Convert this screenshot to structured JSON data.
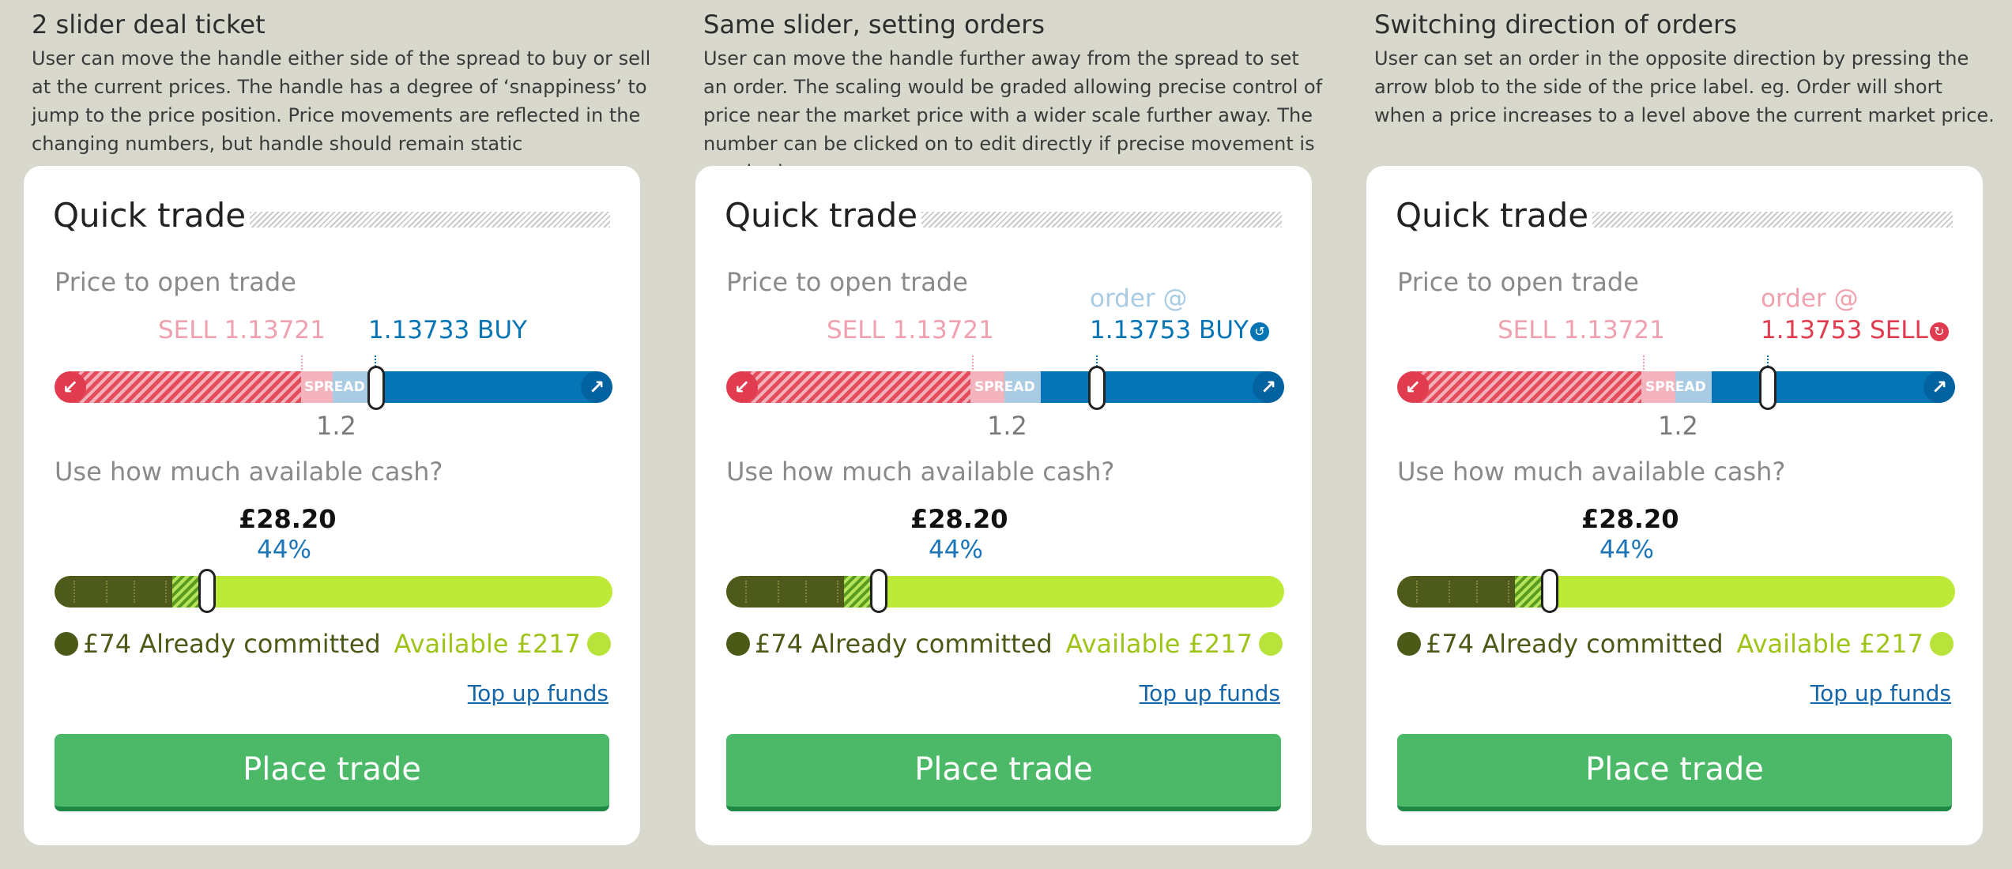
{
  "panels": [
    {
      "title": "2 slider deal ticket",
      "description": "User can move the handle either side of the spread to buy or sell at the current prices. The handle has a degree of ‘snappiness’ to jump to the price position. Price movements are reflected in the changing numbers, but handle should remain static",
      "card": {
        "heading": "Quick trade",
        "price_label": "Price to open trade",
        "sell_label": "SELL 1.13721",
        "order_label": "",
        "buy_label": "1.13733 BUY",
        "spread_text": "SPREAD",
        "spread_value": "1.2",
        "cash_label": "Use how much available cash?",
        "cash_amount": "£28.20",
        "cash_percent": "44%",
        "committed_label": "£74 Already committed",
        "available_label": "Available £217",
        "topup_label": "Top up funds",
        "place_label": "Place trade"
      }
    },
    {
      "title": "Same slider, setting orders",
      "description": "User can move the handle further away from the spread to set an order. The scaling would be graded allowing precise control of price near the market price with a wider scale further away. The number can be clicked on to edit directly if precise movement is required.",
      "card": {
        "heading": "Quick trade",
        "price_label": "Price to open trade",
        "sell_label": "SELL 1.13721",
        "order_label": "order @",
        "buy_label": "1.13753 BUY",
        "spread_text": "SPREAD",
        "spread_value": "1.2",
        "cash_label": "Use how much available cash?",
        "cash_amount": "£28.20",
        "cash_percent": "44%",
        "committed_label": "£74 Already committed",
        "available_label": "Available £217",
        "topup_label": "Top up funds",
        "place_label": "Place trade"
      }
    },
    {
      "title": "Switching direction of orders",
      "description": "User can set an order in the opposite direction by pressing the arrow blob to the side of the price label. eg. Order will short when a price increases to a level above the current market price.",
      "card": {
        "heading": "Quick trade",
        "price_label": "Price to open trade",
        "sell_label": "SELL 1.13721",
        "order_label": "order @",
        "buy_label": "1.13753 SELL",
        "spread_text": "SPREAD",
        "spread_value": "1.2",
        "cash_label": "Use how much available cash?",
        "cash_amount": "£28.20",
        "cash_percent": "44%",
        "committed_label": "£74 Already committed",
        "available_label": "Available £217",
        "topup_label": "Top up funds",
        "place_label": "Place trade"
      }
    }
  ],
  "cash_slider": {
    "committed_fraction": 0.34,
    "selected_fraction": 0.44
  },
  "icons": {
    "sell_arrow": "arrow-down-left-icon",
    "buy_arrow": "arrow-up-right-icon",
    "switch_direction": "switch-direction-icon"
  },
  "colors": {
    "sell": "#e03b4e",
    "sell_light": "#f0a1ae",
    "buy": "#0575b5",
    "order_label": "#a9cce4",
    "committed": "#4b5a17",
    "available": "#bdea36",
    "place_button": "#4bb967",
    "link": "#1466a8"
  }
}
